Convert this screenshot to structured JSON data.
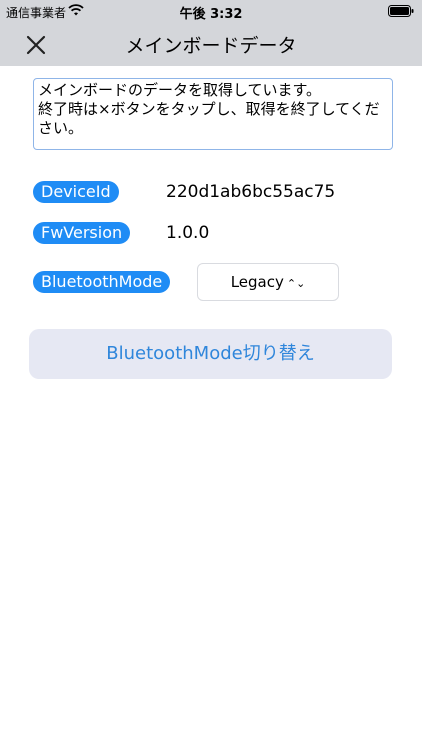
{
  "status_bar": {
    "carrier": "通信事業者",
    "time": "午後 3:32"
  },
  "nav": {
    "title": "メインボードデータ",
    "close_icon": "close-x-icon"
  },
  "message": "メインボードのデータを取得しています。\n終了時は×ボタンをタップし、取得を終了してください。",
  "fields": {
    "device_id": {
      "label": "DeviceId",
      "value": "220d1ab6bc55ac75"
    },
    "fw_version": {
      "label": "FwVersion",
      "value": "1.0.0"
    },
    "bluetooth_mode": {
      "label": "BluetoothMode",
      "selected": "Legacy"
    }
  },
  "switch_button_label": "BluetoothMode切り替え",
  "colors": {
    "accent": "#1f8cf5",
    "button_text": "#2f86db",
    "button_bg": "#e6e8f3",
    "bar_bg": "#d4d6da"
  }
}
